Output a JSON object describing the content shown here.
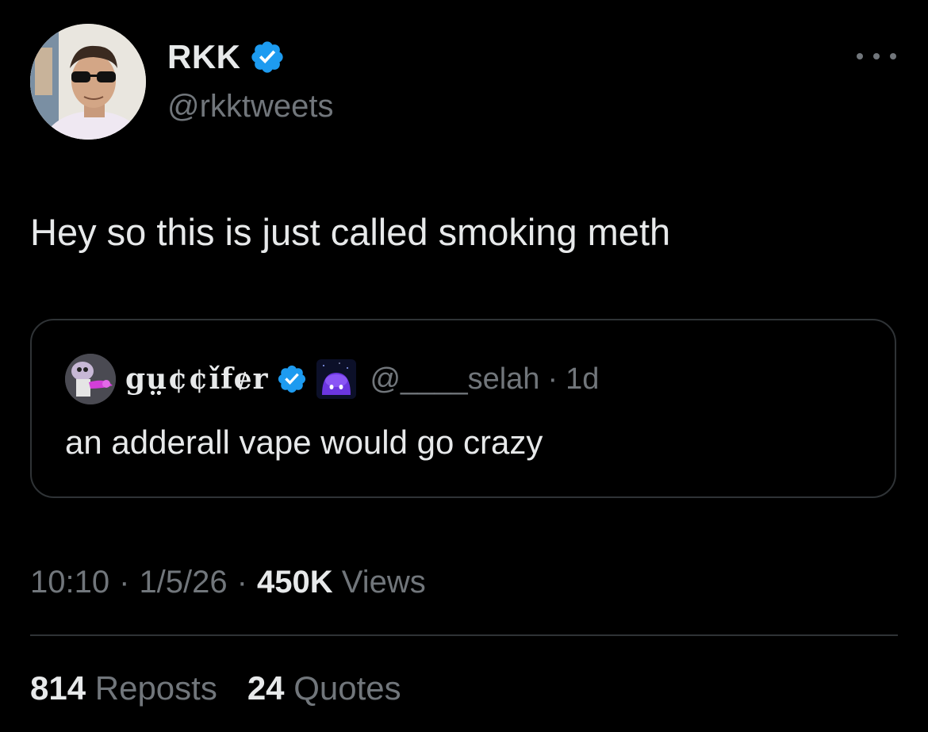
{
  "author": {
    "display_name": "RKK",
    "handle": "@rkktweets",
    "verified_icon": "verified-badge-icon",
    "avatar_icon": "profile-photo-avatar"
  },
  "tweet": {
    "text": "Hey so this is just called smoking meth"
  },
  "quote": {
    "display_name": "gṳ¢¢ǐfɇr",
    "handle": "@____selah",
    "separator": "·",
    "time": "1d",
    "text": "an adderall vape would go crazy",
    "verified_icon": "verified-badge-icon",
    "emoji_icon": "purple-ghost-emoji-icon"
  },
  "meta": {
    "time": "10:10",
    "sep1": "·",
    "date": "1/5/26",
    "sep2": "·",
    "views_count": "450K",
    "views_label": "Views"
  },
  "stats": {
    "reposts_count": "814",
    "reposts_label": "Reposts",
    "quotes_count": "24",
    "quotes_label": "Quotes"
  },
  "colors": {
    "background": "#000000",
    "text_primary": "#e7e9ea",
    "text_secondary": "#71767b",
    "border": "#2f3336",
    "verified_blue": "#1d9bf0"
  }
}
